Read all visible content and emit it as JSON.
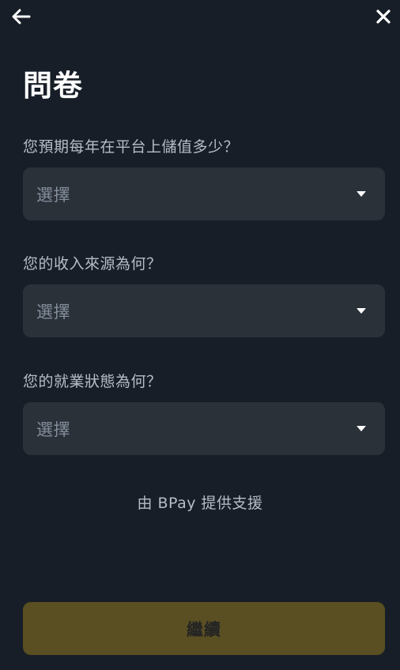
{
  "header": {
    "back_icon": "arrow-left-icon",
    "close_icon": "close-icon"
  },
  "title": "問卷",
  "questions": [
    {
      "label": "您預期每年在平台上儲值多少？",
      "value": "選擇"
    },
    {
      "label": "您的收入來源為何？",
      "value": "選擇"
    },
    {
      "label": "您的就業狀態為何？",
      "value": "選擇"
    }
  ],
  "powered_by": "由 BPay 提供支援",
  "continue_label": "繼續",
  "colors": {
    "background": "#181e27",
    "field": "#2b3139",
    "button": "#5a4f22"
  }
}
